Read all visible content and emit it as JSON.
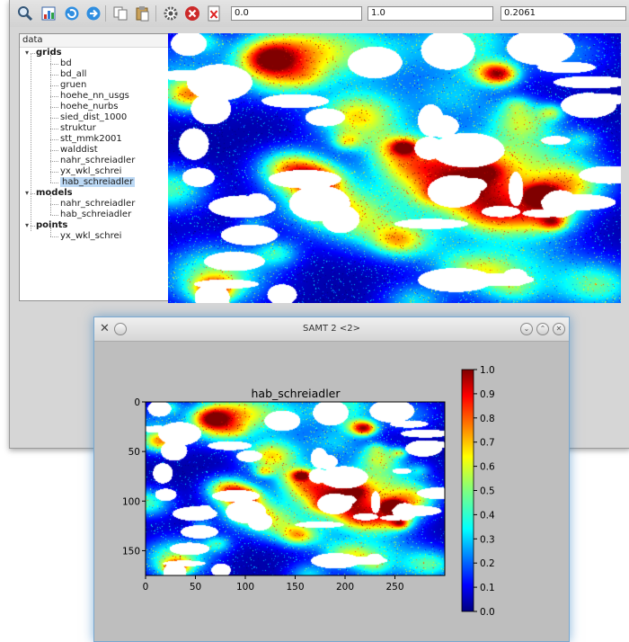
{
  "toolbar": {
    "icons": [
      "zoom-icon",
      "chart-icon",
      "refresh-icon",
      "forward-icon",
      "copy-icon",
      "paste-icon",
      "settings-icon",
      "stop-icon",
      "close-doc-icon"
    ],
    "min_value": "0.0",
    "max_value": "1.0",
    "current_value": "0.2061"
  },
  "tree": {
    "header": "data",
    "groups": [
      {
        "label": "grids",
        "items": [
          "bd",
          "bd_all",
          "gruen",
          "hoehe_nn_usgs",
          "hoehe_nurbs",
          "sied_dist_1000",
          "struktur",
          "stt_mmk2001",
          "walddist",
          "nahr_schreiadler",
          "yx_wkl_schrei",
          "hab_schreiadler"
        ]
      },
      {
        "label": "models",
        "items": [
          "nahr_schreiadler",
          "hab_schreiadler"
        ]
      },
      {
        "label": "points",
        "items": [
          "yx_wkl_schrei"
        ]
      }
    ],
    "selected": "hab_schreiadler"
  },
  "plot_window": {
    "title": "SAMT 2 <2>"
  },
  "colors": {
    "jet_low": "#00007f",
    "jet_mid": "#7fff7f",
    "jet_high": "#7f0000",
    "window_bg": "#bebebe"
  },
  "chart_data": {
    "type": "heatmap",
    "title": "hab_schreiadler",
    "xlabel": "",
    "ylabel": "",
    "xlim": [
      0,
      300
    ],
    "ylim": [
      0,
      175
    ],
    "y_inverted": true,
    "x_ticks": [
      "0",
      "50",
      "100",
      "150",
      "200",
      "250"
    ],
    "y_ticks": [
      "0",
      "50",
      "100",
      "150"
    ],
    "colormap": "jet",
    "colorbar": {
      "range": [
        0.0,
        1.0
      ],
      "ticks": [
        "0.0",
        "0.1",
        "0.2",
        "0.3",
        "0.4",
        "0.5",
        "0.6",
        "0.7",
        "0.8",
        "0.9",
        "1.0"
      ]
    },
    "nodata_color": "#ffffff"
  }
}
